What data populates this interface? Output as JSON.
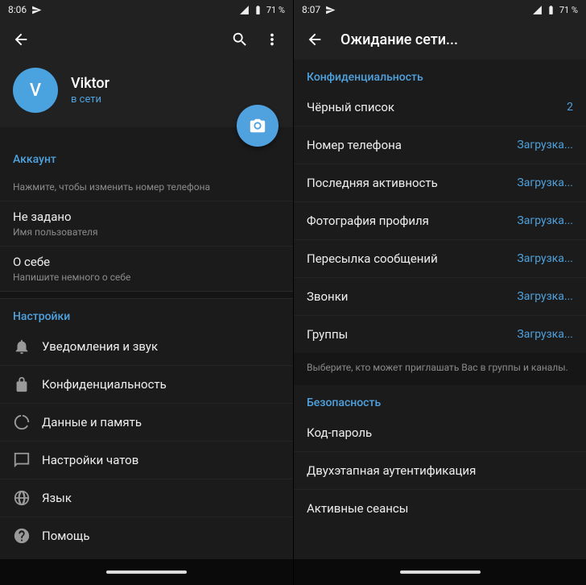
{
  "status_battery": "71 %",
  "left": {
    "time": "8:06",
    "profile_name": "Viktor",
    "profile_status": "в сети",
    "avatar_letter": "V",
    "section_account": "Аккаунт",
    "phone_value": "                ",
    "phone_hint": "Нажмите, чтобы изменить номер телефона",
    "username_value": "Не задано",
    "username_hint": "Имя пользователя",
    "bio_value": "О себе",
    "bio_hint": "Напишите немного о себе",
    "section_settings": "Настройки",
    "settings_items": [
      "Уведомления и звук",
      "Конфиденциальность",
      "Данные и память",
      "Настройки чатов",
      "Язык",
      "Помощь"
    ]
  },
  "right": {
    "time": "8:07",
    "title": "Ожидание сети...",
    "section_privacy": "Конфиденциальность",
    "privacy_rows": [
      {
        "label": "Чёрный список",
        "value": "2"
      },
      {
        "label": "Номер телефона",
        "value": "Загрузка..."
      },
      {
        "label": "Последняя активность",
        "value": "Загрузка..."
      },
      {
        "label": "Фотография профиля",
        "value": "Загрузка..."
      },
      {
        "label": "Пересылка сообщений",
        "value": "Загрузка..."
      },
      {
        "label": "Звонки",
        "value": "Загрузка..."
      },
      {
        "label": "Группы",
        "value": "Загрузка..."
      }
    ],
    "privacy_footnote": "Выберите, кто может приглашать Вас в группы и каналы.",
    "section_security": "Безопасность",
    "security_rows": [
      "Код-пароль",
      "Двухэтапная аутентификация",
      "Активные сеансы"
    ]
  }
}
